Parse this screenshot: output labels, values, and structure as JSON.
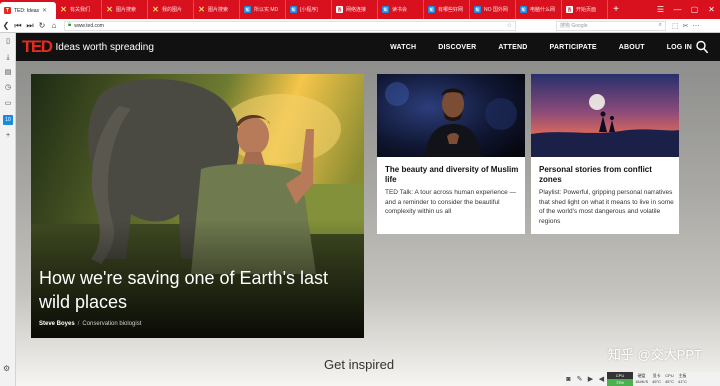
{
  "browser": {
    "tabs": [
      {
        "label": "TED: Ideas",
        "favicon": "T",
        "active": true
      },
      {
        "label": "有关我们",
        "favicon": "x",
        "active": false
      },
      {
        "label": "图片搜索",
        "favicon": "x",
        "active": false
      },
      {
        "label": "我的图片",
        "favicon": "x",
        "active": false
      },
      {
        "label": "图片搜索",
        "favicon": "x",
        "active": false
      },
      {
        "label": "所以实 MD",
        "favicon": "知",
        "active": false
      },
      {
        "label": "[小程序]",
        "favicon": "知",
        "active": false
      },
      {
        "label": "网络连接",
        "favicon": "百",
        "active": false
      },
      {
        "label": "读书会",
        "favicon": "知",
        "active": false
      },
      {
        "label": "有哪些好网",
        "favicon": "知",
        "active": false
      },
      {
        "label": "NO 国外网",
        "favicon": "知",
        "active": false
      },
      {
        "label": "电脑什么网",
        "favicon": "知",
        "active": false
      },
      {
        "label": "开始页面",
        "favicon": "百",
        "active": false
      }
    ],
    "new_tab": "+",
    "url": "www.ted.com",
    "search_placeholder": "搜狗 Google"
  },
  "ted": {
    "logo": "TED",
    "tagline": "Ideas worth spreading",
    "nav": [
      "WATCH",
      "DISCOVER",
      "ATTEND",
      "PARTICIPATE",
      "ABOUT",
      "LOG IN"
    ]
  },
  "hero": {
    "title": "How we're saving one of Earth's last wild places",
    "speaker": "Steve Boyes",
    "separator": "/",
    "role": "Conservation biologist"
  },
  "cards": [
    {
      "title": "The beauty and diversity of Muslim life",
      "description": "TED Talk: A tour across human experience — and a reminder to consider the beautiful complexity within us all"
    },
    {
      "title": "Personal stories from conflict zones",
      "description": "Playlist: Powerful, gripping personal narratives that shed light on what it means to live in some of the world's most dangerous and volatile regions"
    }
  ],
  "section_heading": "Get inspired",
  "watermark": "知乎 @交大PPT",
  "tray": {
    "cpu_label": "CPU",
    "cpu_value": "73%",
    "stats": [
      {
        "top": "硬盘",
        "bottom": "184K/S"
      },
      {
        "top": "显卡",
        "bottom": "45°C"
      },
      {
        "top": "CPU",
        "bottom": "45°C"
      },
      {
        "top": "主板",
        "bottom": "41°C"
      }
    ]
  }
}
